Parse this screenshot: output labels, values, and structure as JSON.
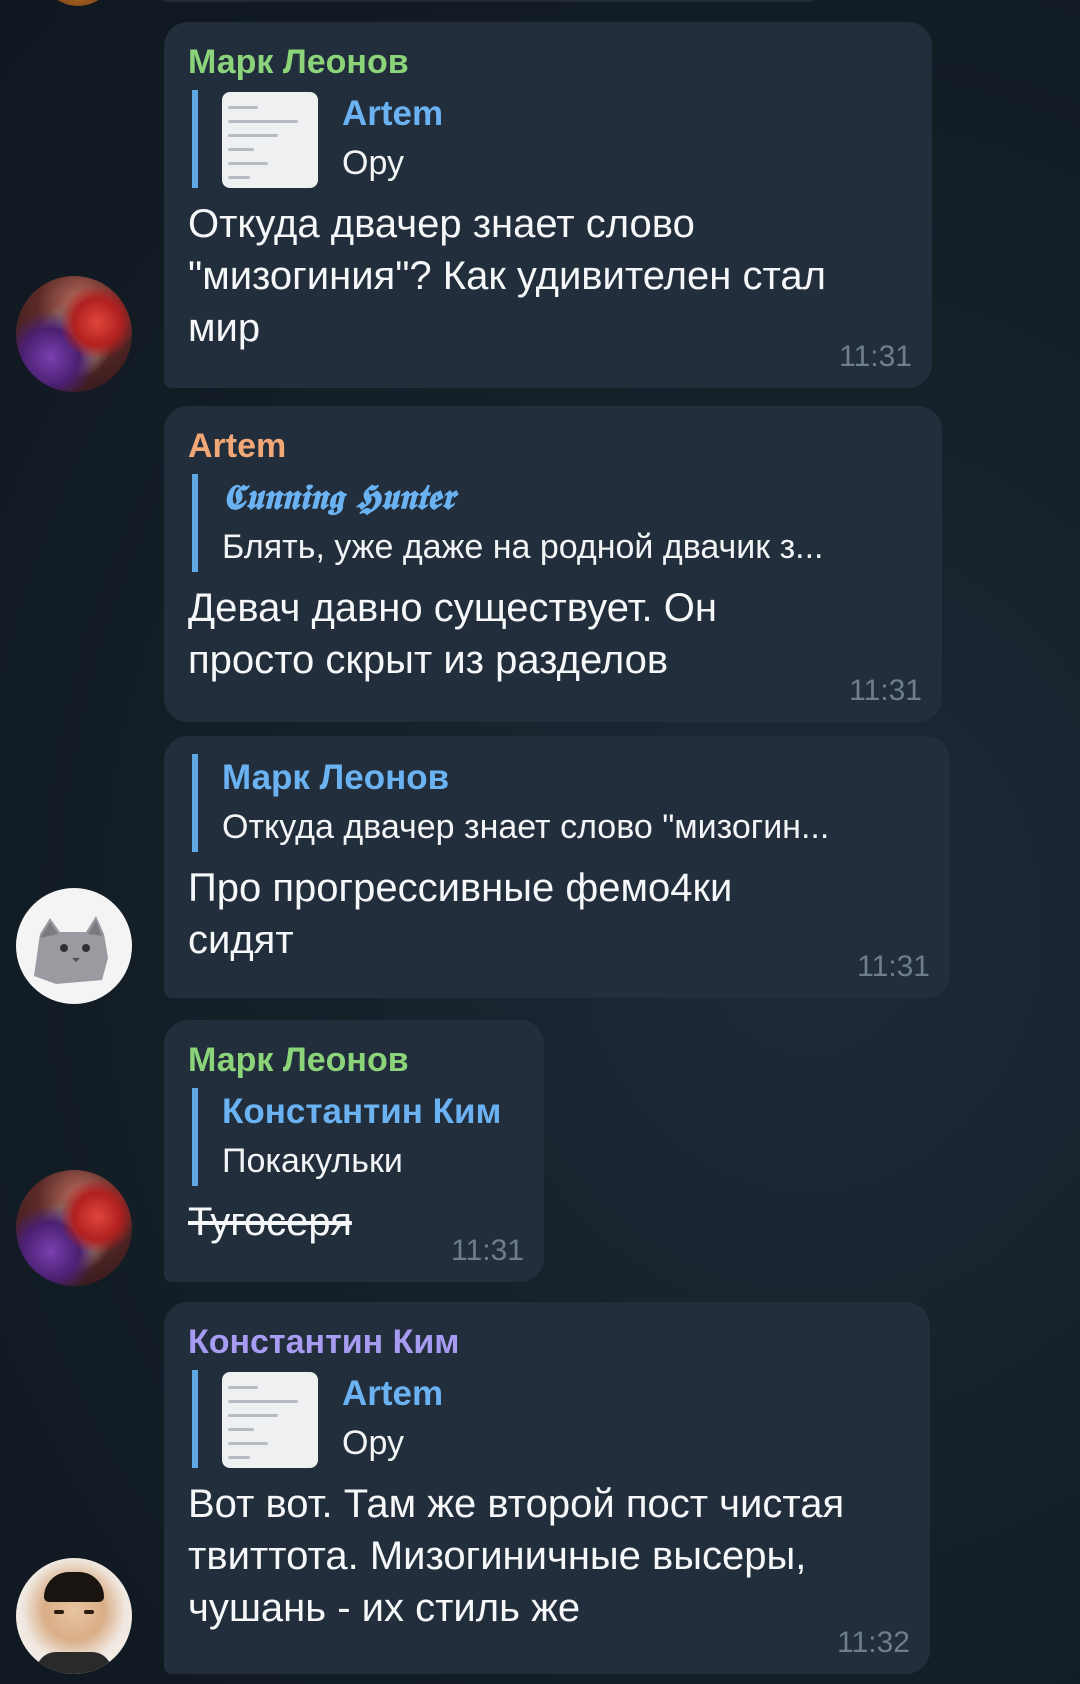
{
  "colors": {
    "background": "#152029",
    "bubble": "#222e3b",
    "reply_bar": "#5fa7e3",
    "reply_name": "#6ab2f2",
    "time": "#6e7e8e",
    "text": "#f5f7f9"
  },
  "messages": [
    {
      "sender": "Марк Леонов",
      "sender_color": "#8bd47a",
      "avatar": "anime-avatar",
      "reply": {
        "name": "Artem",
        "text": "Ору",
        "has_thumbnail": true
      },
      "text": "Откуда двачер знает слово \"мизогиния\"? Как удивителен стал мир",
      "time": "11:31"
    },
    {
      "sender": "Artem",
      "sender_color": "#f2a777",
      "avatar": "",
      "reply": {
        "name": "𝕮𝖚𝖓𝖓𝖎𝖓𝖌 𝕳𝖚𝖓𝖙𝖊𝖗",
        "text": "Блять, уже даже на родной двачик з...",
        "has_thumbnail": false
      },
      "text": "Девач давно существует. Он просто скрыт из разделов",
      "time": "11:31"
    },
    {
      "sender": "",
      "avatar": "cat-avatar",
      "reply": {
        "name": "Марк Леонов",
        "text": "Откуда двачер знает слово \"мизогин...",
        "has_thumbnail": false
      },
      "text": "Про прогрессивные фемо4ки сидят",
      "time": "11:31"
    },
    {
      "sender": "Марк Леонов",
      "sender_color": "#8bd47a",
      "avatar": "anime-avatar",
      "reply": {
        "name": "Константин Ким",
        "text": "Покакульки",
        "has_thumbnail": false
      },
      "text": "Тугосеря",
      "strikethrough": true,
      "time": "11:31"
    },
    {
      "sender": "Константин Ким",
      "sender_color": "#a79bf2",
      "avatar": "face-avatar",
      "reply": {
        "name": "Artem",
        "text": "Ору",
        "has_thumbnail": true
      },
      "text": "Вот вот. Там же второй пост чистая твиттота. Мизогиничные высеры, чушань - их стиль же",
      "time": "11:32"
    }
  ]
}
